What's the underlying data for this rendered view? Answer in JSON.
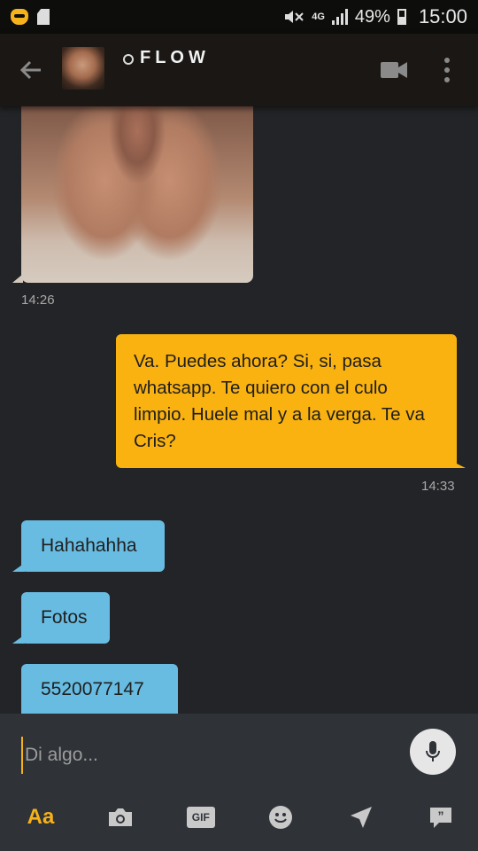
{
  "status_bar": {
    "battery": "49%",
    "network": "4G",
    "time": "15:00"
  },
  "header": {
    "contact_name": "FLOW"
  },
  "messages": [
    {
      "type": "photo",
      "direction": "in",
      "time": "14:26"
    },
    {
      "type": "text",
      "direction": "out",
      "text": "Va. Puedes ahora? Si, si, pasa whatsapp.  Te quiero con el culo limpio. Huele mal y a la verga. Te va Cris?",
      "time": "14:33"
    },
    {
      "type": "text",
      "direction": "in",
      "text": "Hahahahha"
    },
    {
      "type": "text",
      "direction": "in",
      "text": "Fotos"
    },
    {
      "type": "text",
      "direction": "in",
      "text": "5520077147"
    }
  ],
  "composer": {
    "placeholder": "Di algo...",
    "toolbar": {
      "text_style_label": "Aa",
      "gif_label": "GIF"
    }
  },
  "colors": {
    "accent": "#f9b210",
    "incoming_bubble": "#68bce2",
    "background": "#232427"
  }
}
